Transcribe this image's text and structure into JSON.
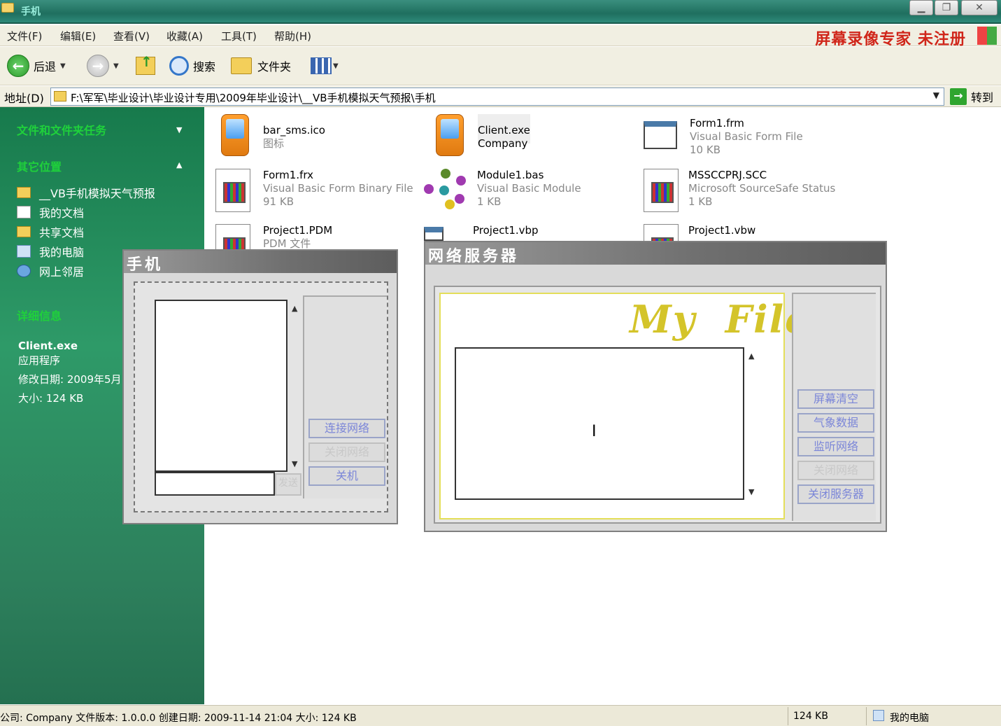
{
  "window": {
    "title": "手机"
  },
  "menu": [
    "文件(F)",
    "编辑(E)",
    "查看(V)",
    "收藏(A)",
    "工具(T)",
    "帮助(H)"
  ],
  "watermark": "屏幕录像专家  未注册",
  "toolbar": {
    "back": "后退",
    "search": "搜索",
    "folders": "文件夹"
  },
  "address": {
    "label": "地址(D)",
    "path": "F:\\军军\\毕业设计\\毕业设计专用\\2009年毕业设计\\__VB手机模拟天气预报\\手机",
    "go": "转到"
  },
  "left_pane": {
    "tasks_head": "文件和文件夹任务",
    "places_head": "其它位置",
    "places": [
      "__VB手机模拟天气预报",
      "我的文档",
      "共享文档",
      "我的电脑",
      "网上邻居"
    ],
    "details_head": "详细信息",
    "details": {
      "name": "Client.exe",
      "type": "应用程序",
      "modified": "修改日期: 2009年5月",
      "size": "大小: 124 KB"
    }
  },
  "files": [
    {
      "name": "bar_sms.ico",
      "line2": "图标",
      "line3": "",
      "icon": "phone-icon"
    },
    {
      "name": "Client.exe",
      "line2": "Company",
      "line3": "",
      "icon": "phone-icon"
    },
    {
      "name": "Form1.frm",
      "line2": "Visual Basic Form File",
      "line3": "10 KB",
      "icon": "vb-form-icon"
    },
    {
      "name": "Form1.frx",
      "line2": "Visual Basic Form Binary File",
      "line3": "91 KB",
      "icon": "vb-binary-icon"
    },
    {
      "name": "Module1.bas",
      "line2": "Visual Basic Module",
      "line3": "1 KB",
      "icon": "vb-module-icon"
    },
    {
      "name": "MSSCCPRJ.SCC",
      "line2": "Microsoft SourceSafe Status",
      "line3": "1 KB",
      "icon": "scc-icon"
    },
    {
      "name": "Project1.PDM",
      "line2": "PDM 文件",
      "line3": "",
      "icon": "pdm-icon"
    },
    {
      "name": "Project1.vbp",
      "line2": "",
      "line3": "",
      "icon": "vbp-icon"
    },
    {
      "name": "Project1.vbw",
      "line2": "",
      "line3": "",
      "icon": "vbw-icon"
    }
  ],
  "phone_window": {
    "title": "手机",
    "send": "发送",
    "connect": "连接网络",
    "close_net": "关闭网络",
    "shutdown": "关机"
  },
  "server_window": {
    "title": "网络服务器",
    "logo": "My  File",
    "clear": "屏幕清空",
    "weather": "气象数据",
    "listen": "监听网络",
    "close_net": "关闭网络",
    "close_server": "关闭服务器"
  },
  "status": {
    "info": "公司: Company 文件版本: 1.0.0.0 创建日期: 2009-11-14 21:04 大小: 124 KB",
    "size": "124 KB",
    "location": "我的电脑"
  },
  "colors": {
    "pane_green": "#2e9a68",
    "section_head": "#1fd13b",
    "watermark_red": "#d0261a",
    "vb_button_text": "#7b86d8"
  }
}
